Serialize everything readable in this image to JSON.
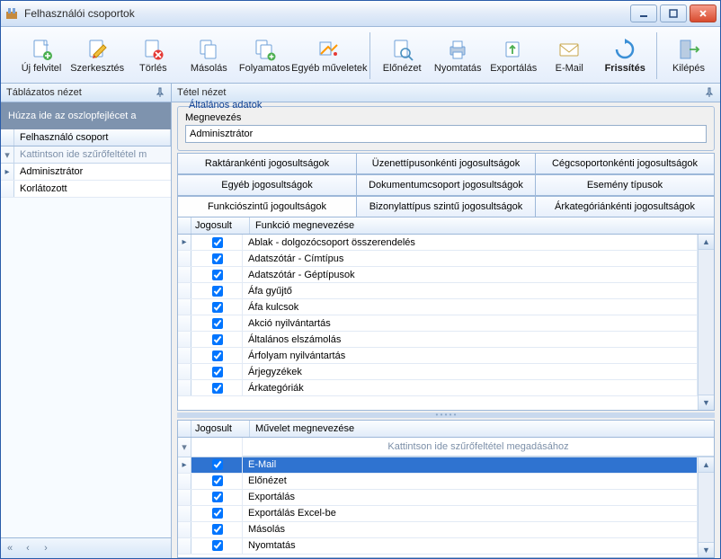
{
  "window": {
    "title": "Felhasználói csoportok"
  },
  "toolbar": {
    "new": "Új felvitel",
    "edit": "Szerkesztés",
    "delete": "Törlés",
    "copy": "Másolás",
    "cont": "Folyamatos",
    "other": "Egyéb műveletek",
    "preview": "Előnézet",
    "print": "Nyomtatás",
    "export": "Exportálás",
    "email": "E-Mail",
    "refresh": "Frissítés",
    "exit": "Kilépés"
  },
  "left": {
    "header": "Táblázatos nézet",
    "dropHint": "Húzza ide az oszlopfejlécet a",
    "col": "Felhasználó csoport",
    "filterHint": "Kattintson ide szűrőfeltétel m",
    "rows": [
      "Adminisztrátor",
      "Korlátozott"
    ]
  },
  "detail": {
    "header": "Tétel nézet",
    "groupTitle": "Általános adatok",
    "nameLabel": "Megnevezés",
    "nameValue": "Adminisztrátor"
  },
  "tabs": {
    "r1": [
      "Raktárankénti jogosultságok",
      "Üzenettípusonkénti jogosultságok",
      "Cégcsoportonkénti jogosultságok"
    ],
    "r2": [
      "Egyéb jogosultságok",
      "Dokumentumcsoport jogosultságok",
      "Esemény típusok"
    ],
    "r3": [
      "Funkciószintű jogoultságok",
      "Bizonylattípus szintű jogosultságok",
      "Árkategóriánkénti jogosultságok"
    ]
  },
  "grid1": {
    "col1": "Jogosult",
    "col2": "Funkció megnevezése",
    "rows": [
      "Ablak - dolgozócsoport összerendelés",
      "Adatszótár - Címtípus",
      "Adatszótár - Géptípusok",
      "Áfa gyűjtő",
      "Áfa kulcsok",
      "Akció nyilvántartás",
      "Általános elszámolás",
      "Árfolyam nyilvántartás",
      "Árjegyzékek",
      "Árkategóriák"
    ]
  },
  "grid2": {
    "col1": "Jogosult",
    "col2": "Művelet megnevezése",
    "filterHint": "Kattintson ide szűrőfeltétel megadásához",
    "rows": [
      "E-Mail",
      "Előnézet",
      "Exportálás",
      "Exportálás Excel-be",
      "Másolás",
      "Nyomtatás"
    ]
  }
}
